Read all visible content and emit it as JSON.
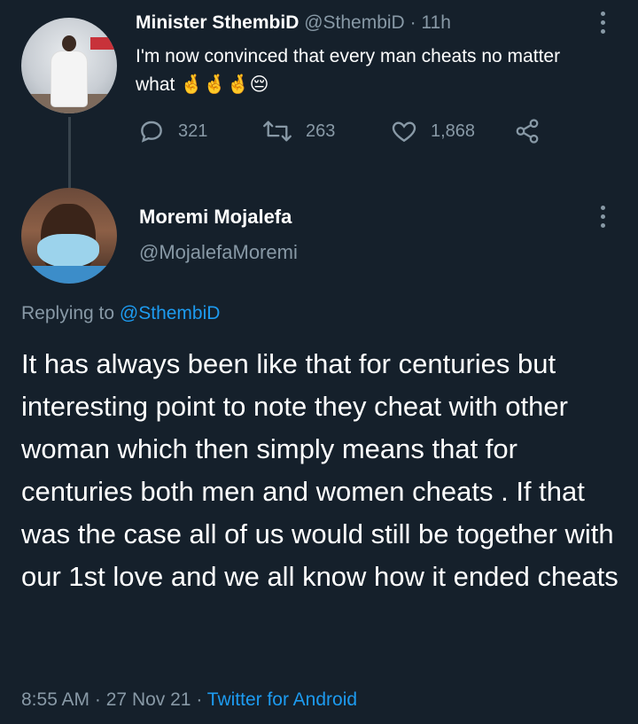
{
  "parent_tweet": {
    "author_name": "Minister SthembiD",
    "handle": "@SthembiD",
    "separator": "·",
    "time": "11h",
    "text": "I'm now convinced that every man cheats no matter what 🤞🤞🤞😔",
    "actions": {
      "replies": "321",
      "retweets": "263",
      "likes": "1,868"
    },
    "icons": [
      "reply-icon",
      "retweet-icon",
      "like-icon",
      "share-icon",
      "more-icon"
    ]
  },
  "reply_tweet": {
    "author_name": "Moremi Mojalefa",
    "handle": "@MojalefaMoremi",
    "replying_prefix": "Replying to",
    "replying_handle": "@SthembiD",
    "text": "It has always been like that for centuries but interesting point to note they cheat with other woman which then simply means that for centuries both men and women cheats . If that was the case all of us would still be together with our 1st love and we all know how it ended cheats",
    "time": "8:55 AM",
    "date": "27 Nov 21",
    "meta_separator": "·",
    "source": "Twitter for Android"
  },
  "colors": {
    "background": "#15202b",
    "text": "#ffffff",
    "muted": "#8899a6",
    "link": "#1d9bf0",
    "thread_line": "#38444d"
  }
}
